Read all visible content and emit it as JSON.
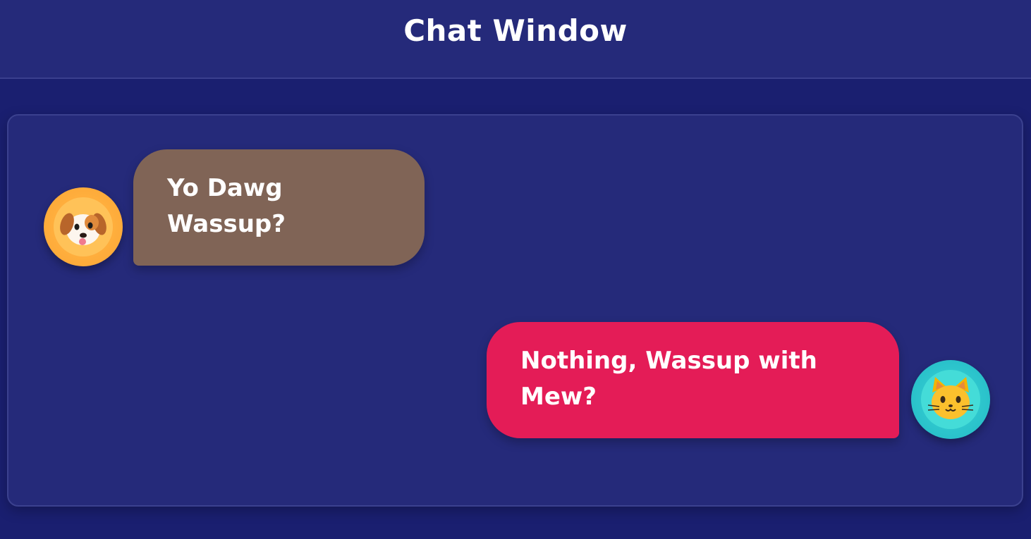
{
  "header": {
    "title": "Chat Window"
  },
  "messages": [
    {
      "sender_icon": "dog-face-icon",
      "lines": [
        "Yo Dawg",
        "Wassup?"
      ],
      "bubble_color": "#806456",
      "avatar_color": "#ffae3d"
    },
    {
      "sender_icon": "cat-face-icon",
      "lines": [
        "Nothing, Wassup with",
        "Mew?"
      ],
      "bubble_color": "#e41c57",
      "avatar_color": "#2cc4cc"
    }
  ],
  "colors": {
    "page_background": "#1a1f70",
    "panel_background": "#252a7a",
    "text": "#ffffff"
  }
}
